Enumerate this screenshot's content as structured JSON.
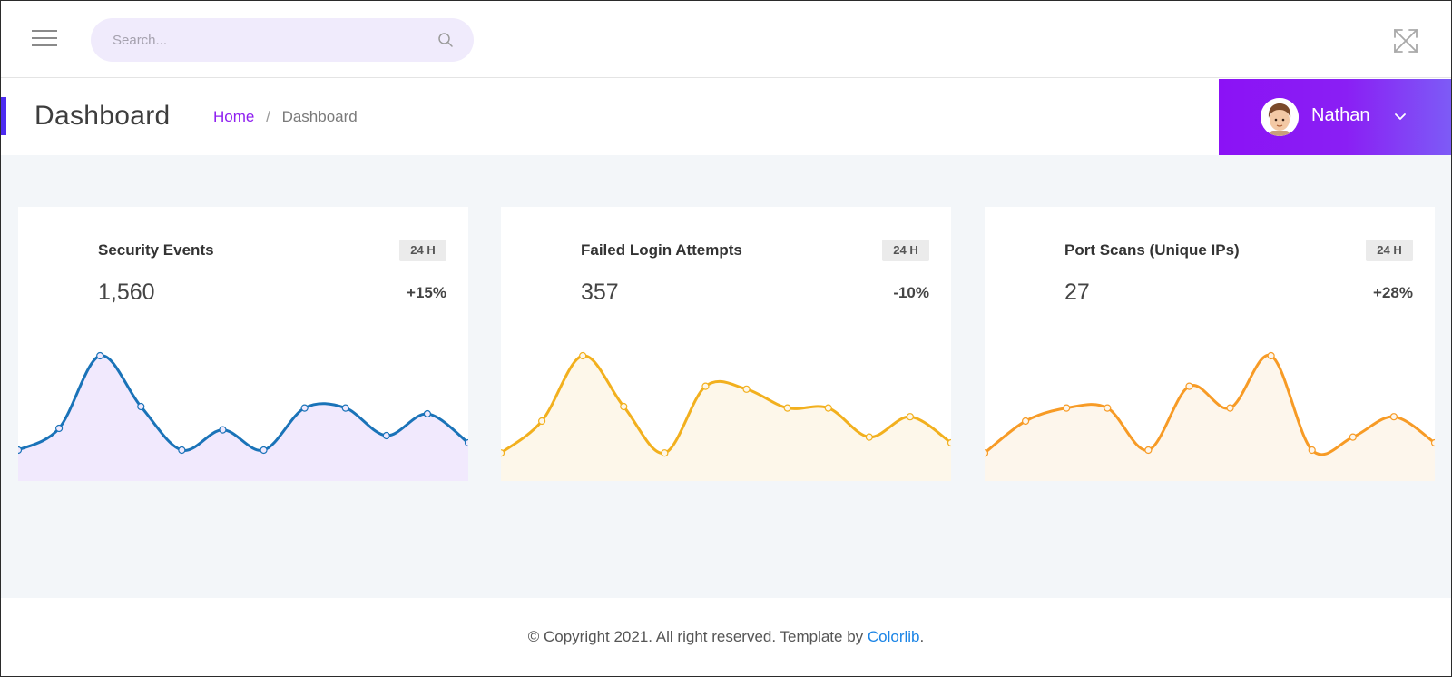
{
  "search": {
    "placeholder": "Search..."
  },
  "page_header": {
    "title": "Dashboard",
    "breadcrumb": {
      "home": "Home",
      "separator": "/",
      "current": "Dashboard"
    }
  },
  "user": {
    "name": "Nathan"
  },
  "colors": {
    "accent_purple": "#8b12f5",
    "blue_line": "#1a73b8",
    "yellow_line": "#f2b01e",
    "orange_line": "#f79b26"
  },
  "cards": [
    {
      "title": "Security Events",
      "badge": "24 H",
      "value": "1,560",
      "change": "+15%",
      "line_color": "#1a73b8",
      "fill_color": "#f1e9fd",
      "points": [
        20,
        35,
        85,
        50,
        20,
        34,
        20,
        49,
        49,
        30,
        45,
        25
      ]
    },
    {
      "title": "Failed Login Attempts",
      "badge": "24 H",
      "value": "357",
      "change": "-10%",
      "line_color": "#f2b01e",
      "fill_color": "#fdf7ea",
      "points": [
        18,
        40,
        85,
        50,
        18,
        64,
        62,
        49,
        49,
        29,
        43,
        25
      ]
    },
    {
      "title": "Port Scans (Unique IPs)",
      "badge": "24 H",
      "value": "27",
      "change": "+28%",
      "line_color": "#f79b26",
      "fill_color": "#fdf6ec",
      "points": [
        18,
        40,
        49,
        49,
        20,
        64,
        49,
        85,
        20,
        29,
        43,
        25
      ]
    }
  ],
  "footer": {
    "text": "© Copyright 2021. All right reserved. Template by ",
    "link": "Colorlib",
    "end": "."
  }
}
